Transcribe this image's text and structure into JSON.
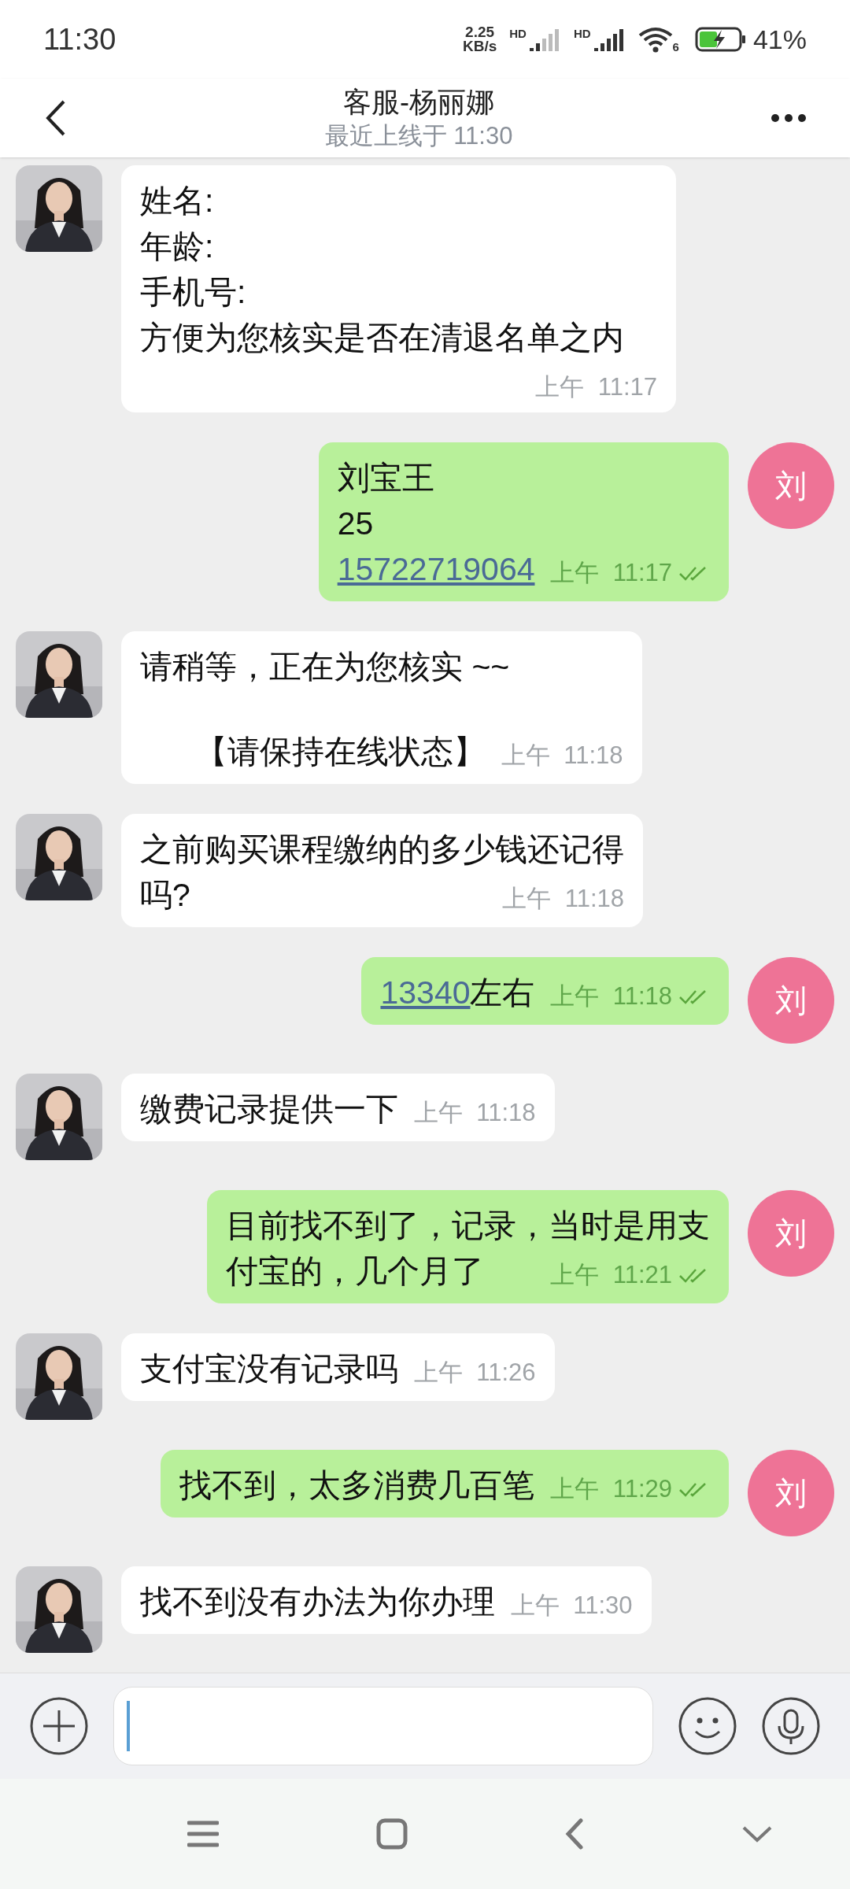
{
  "status_bar": {
    "time": "11:30",
    "net_speed": "2.25",
    "net_unit": "KB/s",
    "sim_labels": [
      "HD",
      "HD"
    ],
    "wifi_label": "6",
    "battery": "41%"
  },
  "header": {
    "title": "客服-杨丽娜",
    "subtitle": "最近上线于 11:30"
  },
  "messages": [
    {
      "kind": "received",
      "lines": [
        [
          {
            "text": "姓名:",
            "kind": "plain"
          }
        ],
        [
          {
            "text": "年龄:",
            "kind": "plain"
          }
        ],
        [
          {
            "text": "手机号:",
            "kind": "plain"
          }
        ],
        [
          {
            "text": "方便为您核实是否在清退名单之内",
            "kind": "plain"
          }
        ]
      ],
      "time": "上午  11:17"
    },
    {
      "kind": "sent",
      "avatar": "刘",
      "lines": [
        [
          {
            "text": "刘宝王",
            "kind": "plain"
          }
        ],
        [
          {
            "text": "25",
            "kind": "plain"
          }
        ],
        [
          {
            "text": "15722719064",
            "kind": "link"
          }
        ]
      ],
      "time": "上午  11:17",
      "read": true
    },
    {
      "kind": "received",
      "lines": [
        [
          {
            "text": "请稍等，正在为您核实 ~~",
            "kind": "plain"
          }
        ],
        [
          {
            "text": "【请保持在线状态】",
            "kind": "center"
          }
        ]
      ],
      "time": "上午  11:18"
    },
    {
      "kind": "received",
      "lines": [
        [
          {
            "text": "之前购买课程缴纳的多少钱还记得",
            "kind": "plain"
          }
        ],
        [
          {
            "text": "吗?",
            "kind": "plain"
          }
        ]
      ],
      "time": "上午  11:18"
    },
    {
      "kind": "sent",
      "avatar": "刘",
      "lines": [
        [
          {
            "text": "13340",
            "kind": "link"
          },
          {
            "text": "左右",
            "kind": "plain"
          }
        ]
      ],
      "time": "上午  11:18",
      "read": true
    },
    {
      "kind": "received",
      "lines": [
        [
          {
            "text": "缴费记录提供一下",
            "kind": "plain"
          }
        ]
      ],
      "time": "上午  11:18"
    },
    {
      "kind": "sent",
      "avatar": "刘",
      "lines": [
        [
          {
            "text": "目前找不到了，记录，当时是用支",
            "kind": "plain"
          }
        ],
        [
          {
            "text": "付宝的，几个月了",
            "kind": "plain"
          }
        ]
      ],
      "time": "上午  11:21",
      "read": true
    },
    {
      "kind": "received",
      "lines": [
        [
          {
            "text": "支付宝没有记录吗",
            "kind": "plain"
          }
        ]
      ],
      "time": "上午  11:26"
    },
    {
      "kind": "sent",
      "avatar": "刘",
      "lines": [
        [
          {
            "text": "找不到，太多消费几百笔",
            "kind": "plain"
          }
        ]
      ],
      "time": "上午  11:29",
      "read": true
    },
    {
      "kind": "received",
      "lines": [
        [
          {
            "text": "找不到没有办法为你办理",
            "kind": "plain"
          }
        ]
      ],
      "time": "上午  11:30"
    }
  ]
}
